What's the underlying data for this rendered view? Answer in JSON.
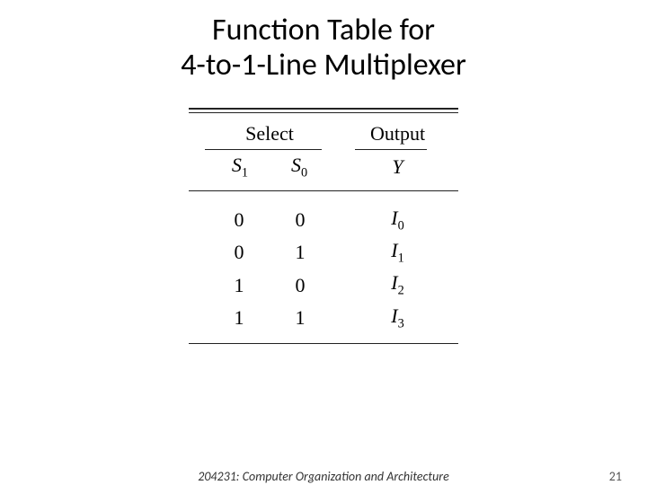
{
  "title_line1": "Function Table for",
  "title_line2": "4-to-1-Line Multiplexer",
  "header": {
    "select_label": "Select",
    "output_label": "Output"
  },
  "subheader": {
    "s1_base": "S",
    "s1_sub": "1",
    "s0_base": "S",
    "s0_sub": "0",
    "y_label": "Y"
  },
  "rows": [
    {
      "s1": "0",
      "s0": "0",
      "yb": "I",
      "ys": "0"
    },
    {
      "s1": "0",
      "s0": "1",
      "yb": "I",
      "ys": "1"
    },
    {
      "s1": "1",
      "s0": "0",
      "yb": "I",
      "ys": "2"
    },
    {
      "s1": "1",
      "s0": "1",
      "yb": "I",
      "ys": "3"
    }
  ],
  "footer": {
    "course": "204231: Computer Organization and Architecture",
    "page": "21"
  }
}
